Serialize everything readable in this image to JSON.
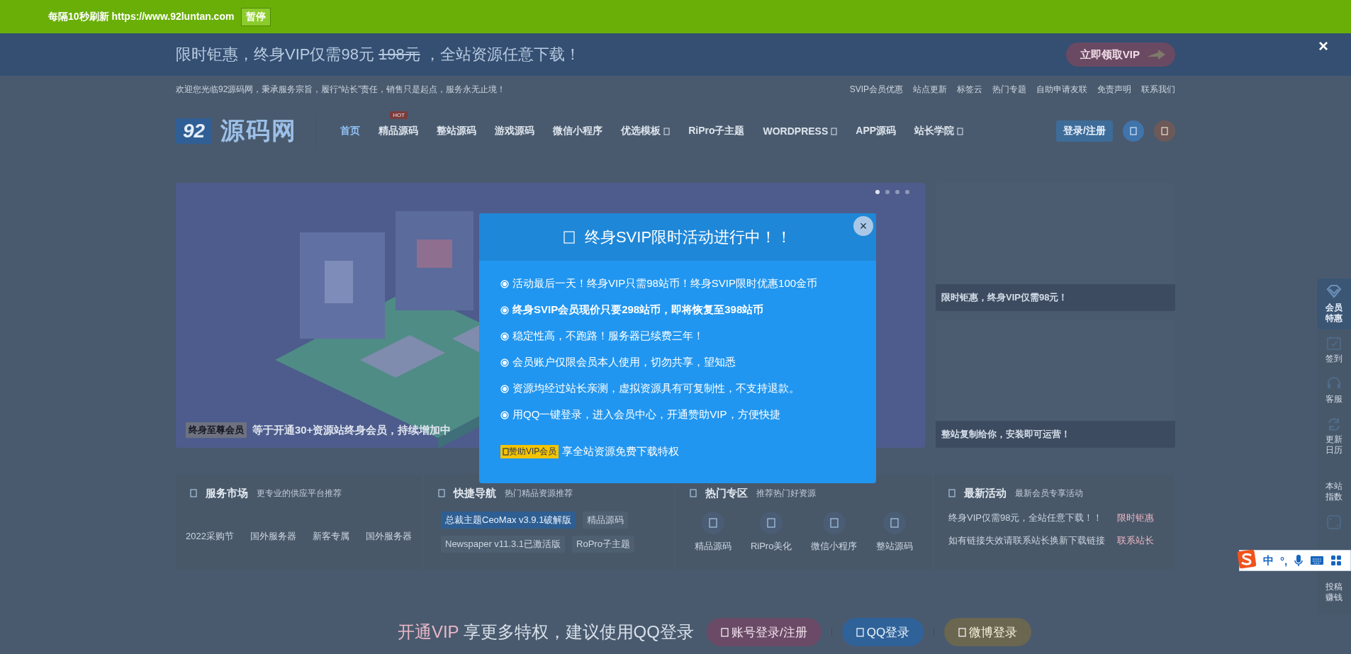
{
  "refresh_bar": {
    "text": "每隔10秒刷新 https://www.92luntan.com",
    "pause_button": "暂停"
  },
  "promo_banner": {
    "text_before": "限时钜惠，终身VIP仅需98元",
    "old_price": "198元",
    "text_after": "，全站资源任意下载！",
    "button": "立即领取VIP",
    "close": "×"
  },
  "top_links": {
    "welcome": "欢迎您光临92源码网，秉承服务宗旨，履行“站长”责任，销售只是起点，服务永无止境！",
    "links": [
      "SVIP会员优惠",
      "站点更新",
      "标签云",
      "热门专题",
      "自助申请友联",
      "免责声明",
      "联系我们"
    ]
  },
  "header": {
    "logo_number": "92",
    "logo_name": "源码网",
    "nav": [
      {
        "label": "首页",
        "selected": true,
        "dropdown": false
      },
      {
        "label": "精品源码",
        "selected": false,
        "dropdown": false,
        "badge": "HOT"
      },
      {
        "label": "整站源码",
        "selected": false,
        "dropdown": false
      },
      {
        "label": "游戏源码",
        "selected": false,
        "dropdown": false
      },
      {
        "label": "微信小程序",
        "selected": false,
        "dropdown": false
      },
      {
        "label": "优选模板",
        "selected": false,
        "dropdown": true
      },
      {
        "label": "RiPro子主题",
        "selected": false,
        "dropdown": false
      },
      {
        "label": "WORDPRESS",
        "selected": false,
        "dropdown": true
      },
      {
        "label": "APP源码",
        "selected": false,
        "dropdown": false
      },
      {
        "label": "站长学院",
        "selected": false,
        "dropdown": true
      }
    ],
    "login_button": "登录/注册"
  },
  "slider": {
    "tag": "终身至尊会员",
    "caption": "等于开通30+资源站终身会员，持续增加中",
    "dots": [
      {
        "selected": true
      },
      {
        "selected": false
      },
      {
        "selected": false
      },
      {
        "selected": false
      }
    ]
  },
  "side_cards": [
    {
      "caption": "限时钜惠，终身VIP仅需98元！"
    },
    {
      "caption": "整站复制给你，安装即可运营！"
    }
  ],
  "sections": [
    {
      "kind": "links",
      "title": "服务市场",
      "subtitle": "更专业的供应平台推荐",
      "items": [
        {
          "text": "2022采购节"
        },
        {
          "text": "国外服务器"
        },
        {
          "text": "新客专属"
        },
        {
          "text": "国外服务器"
        }
      ]
    },
    {
      "kind": "tags",
      "title": "快捷导航",
      "subtitle": "热门精品资源推荐",
      "items": [
        {
          "text": "总裁主题CeoMax v3.9.1破解版",
          "selected": true
        },
        {
          "text": "精品源码",
          "selected": false
        },
        {
          "text": "Newspaper v11.3.1已激活版",
          "selected": false
        },
        {
          "text": "RoPro子主题",
          "selected": false
        }
      ]
    },
    {
      "kind": "icons",
      "title": "热门专区",
      "subtitle": "推荐热门好资源",
      "items": [
        {
          "text": "精品源码"
        },
        {
          "text": "RiPro美化"
        },
        {
          "text": "微信小程序"
        },
        {
          "text": "整站源码"
        }
      ]
    },
    {
      "kind": "news",
      "title": "最新活动",
      "subtitle": "最新会员专享活动",
      "items": [
        {
          "text": "终身VIP仅需98元，全站任意下载！！",
          "tag": "限时钜惠"
        },
        {
          "text": "如有链接失效请联系站长换新下载链接",
          "tag": "联系站长"
        }
      ]
    }
  ],
  "sidebar": [
    {
      "label": "会员特惠",
      "selected": true
    },
    {
      "label": "签到",
      "selected": false
    },
    {
      "label": "客服",
      "selected": false
    },
    {
      "label": "更新日历",
      "selected": false
    },
    {
      "label": "本站指数",
      "selected": false
    },
    {
      "selected": false
    },
    {
      "label": "投稿赚钱",
      "selected": false
    }
  ],
  "modal": {
    "title": "终身SVIP限时活动进行中！！",
    "close": "×",
    "items": [
      {
        "text": "活动最后一天！终身VIP只需98站币！终身SVIP限时优惠100金币",
        "bold": false
      },
      {
        "text": "终身SVIP会员现价只要298站币，即将恢复至398站币",
        "bold": true
      },
      {
        "text": "稳定性高，不跑路！服务器已续费三年！",
        "bold": false
      },
      {
        "text": "会员账户仅限会员本人使用，切勿共享，望知悉",
        "bold": false
      },
      {
        "text": "资源均经过站长亲测，虚拟资源具有可复制性，不支持退款。",
        "bold": false
      },
      {
        "text": "用QQ一键登录，进入会员中心，开通赞助VIP，方便快捷",
        "bold": false
      }
    ],
    "vip_tag": "赞助VIP会员",
    "vip_text": "享全站资源免费下载特权"
  },
  "login_bar": {
    "vip": "开通VIP",
    "text": "享更多特权，建议使用QQ登录",
    "buttons": [
      {
        "label": "账号登录/注册",
        "kind": "account"
      },
      {
        "label": "QQ登录",
        "kind": "qq"
      },
      {
        "label": "微博登录",
        "kind": "weibo"
      }
    ]
  },
  "ime_bar": {
    "mode": "中",
    "punct": "°,"
  }
}
